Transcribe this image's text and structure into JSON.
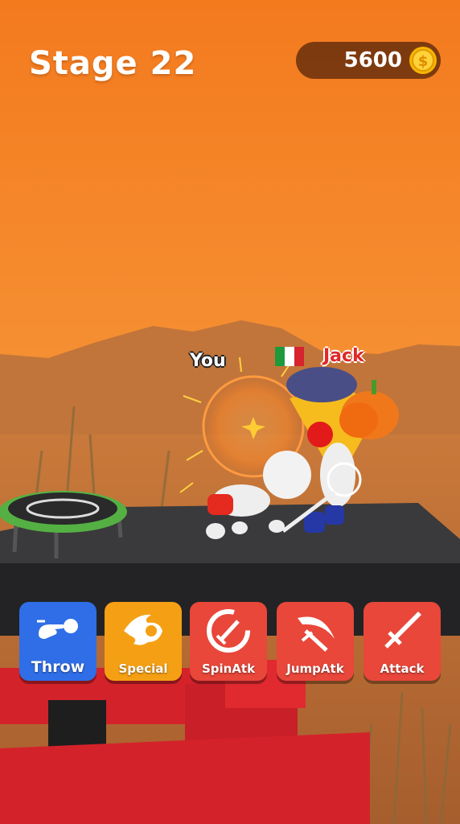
{
  "hud": {
    "stage_label": "Stage 22",
    "coins": "5600",
    "coin_icon": "dollar-coin-icon"
  },
  "players": {
    "you_name": "You",
    "opponent_name": "Jack",
    "opponent_flag": {
      "icon": "italy-flag-icon",
      "colors": [
        "#1e9a3c",
        "#ffffff",
        "#d6232d"
      ]
    }
  },
  "skills": [
    {
      "label": "Throw",
      "icon": "throw-ball-icon",
      "color": "#2f6ee6"
    },
    {
      "label": "Special",
      "icon": "fire-burst-icon",
      "color": "#f5a014"
    },
    {
      "label": "SpinAtk",
      "icon": "spin-sword-icon",
      "color": "#e8473a"
    },
    {
      "label": "JumpAtk",
      "icon": "jump-sword-icon",
      "color": "#e8473a"
    },
    {
      "label": "Attack",
      "icon": "sword-icon",
      "color": "#e8473a"
    }
  ],
  "colors": {
    "sky_top": "#f47a1e",
    "sky_bottom": "#f7a948",
    "platform": "#2e2e30",
    "trampoline": "#55b043"
  }
}
